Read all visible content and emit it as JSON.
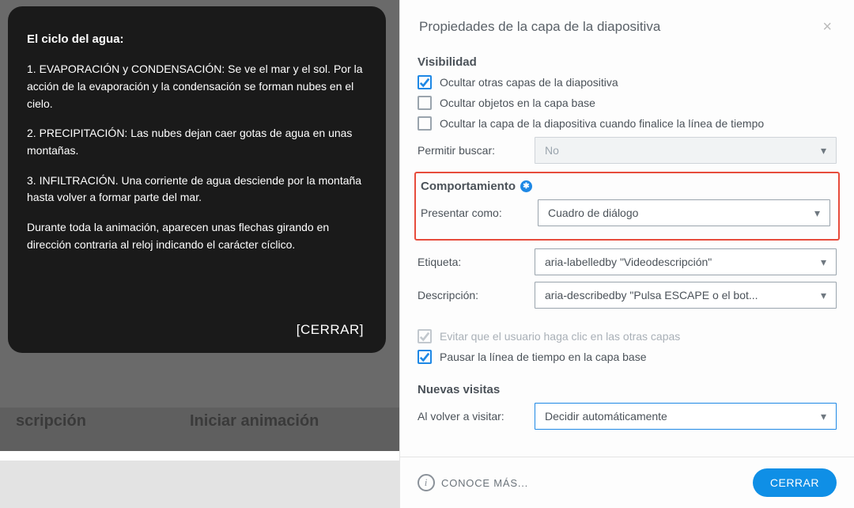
{
  "left": {
    "title": "El ciclo del agua:",
    "p1": "1. EVAPORACIÓN y CONDENSACIÓN: Se ve el mar y el sol. Por la acción de la evaporación y la condensación se forman nubes en el cielo.",
    "p2": "2. PRECIPITACIÓN: Las nubes dejan caer gotas de agua en unas montañas.",
    "p3": "3. INFILTRACIÓN. Una corriente de agua desciende por la montaña hasta volver a formar parte del mar.",
    "p4": "Durante toda la animación, aparecen unas flechas girando en dirección contraria al reloj indicando el carácter cíclico.",
    "close": "[CERRAR]",
    "ghost_a": "scripción",
    "ghost_b": "Iniciar animación"
  },
  "panel": {
    "title": "Propiedades de la capa de la diapositiva",
    "visibility": {
      "heading": "Visibilidad",
      "opt1": "Ocultar otras capas de la diapositiva",
      "opt2": "Ocultar objetos en la capa base",
      "opt3": "Ocultar la capa de la diapositiva cuando finalice la línea de tiempo",
      "search_label": "Permitir buscar:",
      "search_value": "No"
    },
    "behavior": {
      "heading": "Comportamiento",
      "present_label": "Presentar como:",
      "present_value": "Cuadro de diálogo",
      "label_label": "Etiqueta:",
      "label_value": "aria-labelledby \"Videodescripción\"",
      "desc_label": "Descripción:",
      "desc_value": "aria-describedby \"Pulsa ESCAPE o el bot...",
      "prevent": "Evitar que el usuario haga clic en las otras capas",
      "pause": "Pausar la línea de tiempo en la capa base"
    },
    "revisit": {
      "heading": "Nuevas visitas",
      "label": "Al volver a visitar:",
      "value": "Decidir automáticamente"
    },
    "footer": {
      "more": "CONOCE MÁS...",
      "close": "CERRAR"
    }
  }
}
